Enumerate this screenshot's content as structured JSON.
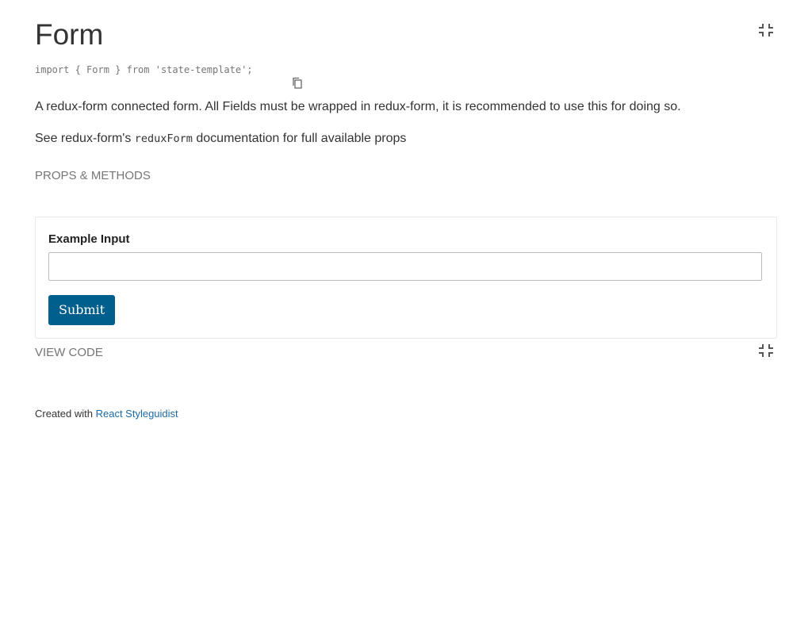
{
  "component": {
    "title": "Form",
    "import_statement": "import { Form } from 'state-template';",
    "copy_icon": "copy-icon",
    "isolate_icon": "collapse-arrows-icon",
    "description": {
      "line1": "A redux-form connected form. All Fields must be wrapped in redux-form, it is recommended to use this for doing so.",
      "line2_before": "See redux-form's ",
      "line2_code": "reduxForm",
      "line2_after": " documentation for full available props"
    },
    "props_tab_label": "PROPS & METHODS"
  },
  "example": {
    "field_label": "Example Input",
    "field_value": "",
    "submit_label": "Submit",
    "view_code_label": "VIEW CODE",
    "accent_color": "#005f8c"
  },
  "footer": {
    "prefix": "Created with ",
    "link_text": "React Styleguidist"
  }
}
